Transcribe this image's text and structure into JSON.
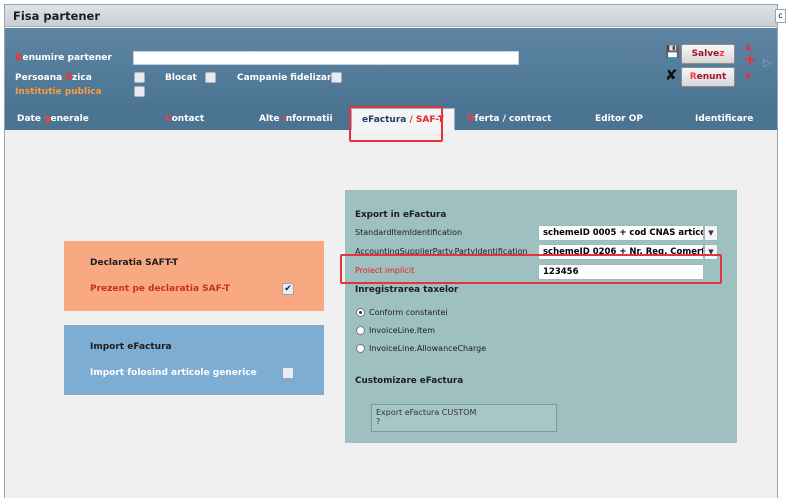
{
  "window": {
    "title": "Fisa partener",
    "corner_glyph": "c"
  },
  "header": {
    "denumire_first": "D",
    "denumire_rest": "enumire partener",
    "denumire_value": "",
    "pf_a": "Persoana ",
    "pf_hl": "f",
    "pf_b": "izica",
    "blocat_label": "Blocat",
    "campanie_label": "Campanie fidelizare",
    "institutie_label": "Institutie publica",
    "save_a": "Salve",
    "save_hl": "z",
    "cancel_first": "R",
    "cancel_rest": "enunt"
  },
  "tabs": [
    {
      "a": "Date ",
      "hl": "g",
      "b": "enerale"
    },
    {
      "a": "",
      "hl": "C",
      "b": "ontact"
    },
    {
      "a": "Alte ",
      "hl": "i",
      "b": "nformatii"
    },
    {
      "a": "eFactura ",
      "hl": "/ SAF-T",
      "b": ""
    },
    {
      "a": "",
      "hl": "O",
      "b": "ferta / contract"
    },
    {
      "a": "Editor OP",
      "hl": "",
      "b": ""
    },
    {
      "a": "Identificare",
      "hl": "",
      "b": ""
    }
  ],
  "efactura": {
    "export_title": "Export in eFactura",
    "std_label": "StandardItemIdentification",
    "std_value": "schemeID  0005 + cod CNAS articol",
    "acc_label": "AccountingSupplierParty.PartyIdentification",
    "acc_value": "schemeID  0206 + Nr. Reg. Comertului",
    "proiect_label": "Proiect implicit",
    "proiect_value": "123456",
    "taxe_title": "Inregistrarea taxelor",
    "radio_options": [
      "Conform constantei",
      "InvoiceLine.Item",
      "InvoiceLine.AllowanceCharge"
    ],
    "radio_selected": "Conform constantei",
    "custom_title": "Customizare eFactura",
    "custom_line1": "Export eFactura CUSTOM",
    "custom_line2": "?"
  },
  "saft": {
    "title": "Declaratia SAFT-T",
    "prezent_label": "Prezent pe declaratia SAF-T",
    "prezent_checked": true,
    "check_glyph": "✔"
  },
  "import": {
    "title": "Import eFactura",
    "generic_label": "Import folosind articole generice",
    "generic_checked": false
  },
  "icons": {
    "save_icon_glyph": "💾",
    "cancel_icon_glyph": "✘",
    "plus_glyph": "+",
    "up_glyph": "▲",
    "down_glyph": "▼",
    "next_glyph": "▷",
    "combo_glyph": "▼"
  },
  "colors": {
    "accent_red": "#e2343f",
    "header_blue": "#4b7392",
    "saft_panel": "#f8a982",
    "import_panel": "#7eadd3",
    "efactura_panel": "#9fc0c0"
  }
}
